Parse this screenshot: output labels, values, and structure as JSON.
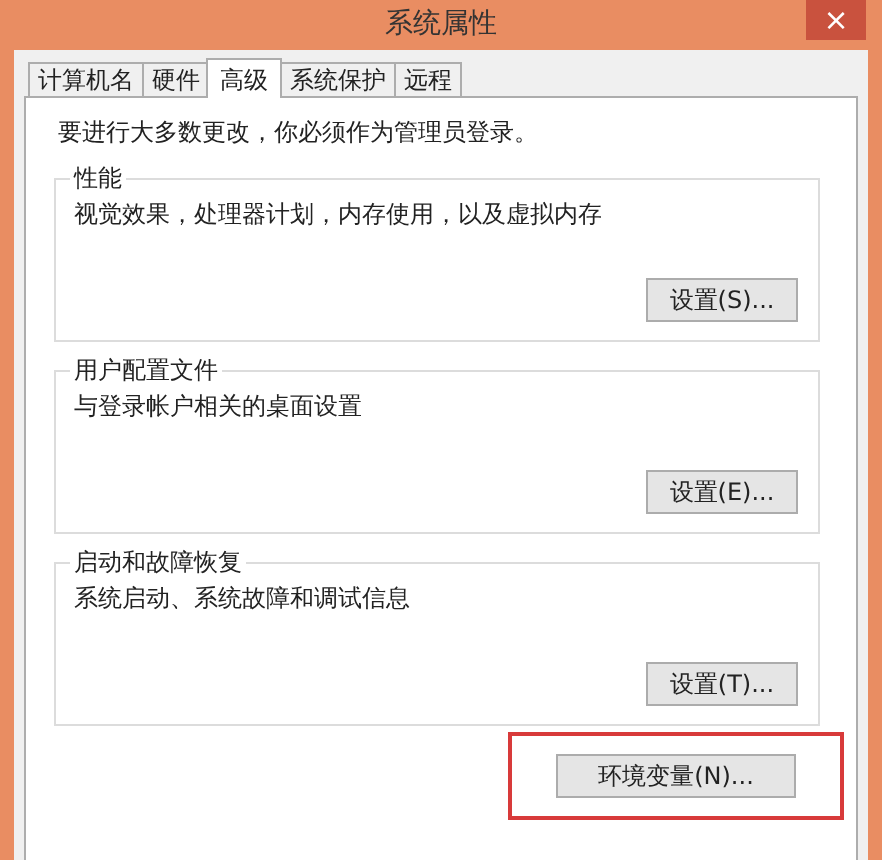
{
  "window": {
    "title": "系统属性",
    "close": "×"
  },
  "tabs": [
    {
      "label": "计算机名",
      "selected": false
    },
    {
      "label": "硬件",
      "selected": false
    },
    {
      "label": "高级",
      "selected": true
    },
    {
      "label": "系统保护",
      "selected": false
    },
    {
      "label": "远程",
      "selected": false
    }
  ],
  "notice": "要进行大多数更改，你必须作为管理员登录。",
  "groups": [
    {
      "title": "性能",
      "description": "视觉效果，处理器计划，内存使用，以及虚拟内存",
      "button": "设置(S)..."
    },
    {
      "title": "用户配置文件",
      "description": "与登录帐户相关的桌面设置",
      "button": "设置(E)..."
    },
    {
      "title": "启动和故障恢复",
      "description": "系统启动、系统故障和调试信息",
      "button": "设置(T)..."
    }
  ],
  "environment_button": {
    "label": "环境变量(N)...",
    "highlighted": true
  }
}
